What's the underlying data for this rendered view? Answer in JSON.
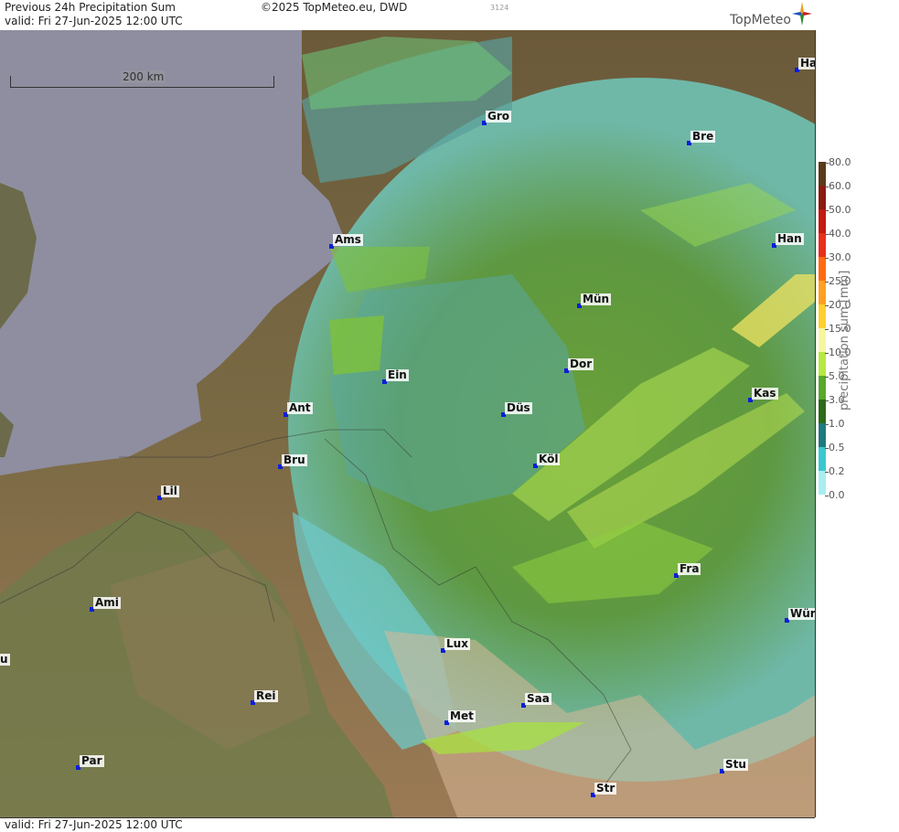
{
  "header": {
    "title": "Previous 24h Precipitation Sum",
    "valid": "valid:  Fri  27-Jun-2025 12:00 UTC",
    "copyright": "©2025 TopMeteo.eu, DWD",
    "code": "3124",
    "brand": "TopMeteo"
  },
  "footer": {
    "valid": "valid:  Fri  27-Jun-2025 12:00 UTC"
  },
  "scale": {
    "label": "200 km"
  },
  "cities": [
    {
      "name": "Gro"
    },
    {
      "name": "Ha"
    },
    {
      "name": "Bre"
    },
    {
      "name": "Ams"
    },
    {
      "name": "Han"
    },
    {
      "name": "Mün"
    },
    {
      "name": "Ein"
    },
    {
      "name": "Dor"
    },
    {
      "name": "Ant"
    },
    {
      "name": "Düs"
    },
    {
      "name": "Kas"
    },
    {
      "name": "Bru"
    },
    {
      "name": "Köl"
    },
    {
      "name": "Lil"
    },
    {
      "name": "Fra"
    },
    {
      "name": "Ami"
    },
    {
      "name": "Wür"
    },
    {
      "name": "u"
    },
    {
      "name": "Lux"
    },
    {
      "name": "Rei"
    },
    {
      "name": "Saa"
    },
    {
      "name": "Met"
    },
    {
      "name": "Par"
    },
    {
      "name": "Stu"
    },
    {
      "name": "Str"
    }
  ],
  "legend": {
    "title": "precipitation sum [mm]",
    "ticks": [
      "80.0",
      "60.0",
      "50.0",
      "40.0",
      "30.0",
      "25.0",
      "20.0",
      "15.0",
      "10.0",
      "5.0",
      "3.0",
      "1.0",
      "0.5",
      "0.2",
      "0.0"
    ],
    "colors": [
      "#5a3a1a",
      "#8b1a10",
      "#c21a10",
      "#e8301a",
      "#ff6a10",
      "#ffa020",
      "#ffd030",
      "#f6f6a0",
      "#b8e840",
      "#5aa82a",
      "#2e6a18",
      "#1e7a80",
      "#3ac8d0",
      "#a8eef0",
      "#ffffff"
    ]
  },
  "colors": {
    "sea": "#8e8ea0",
    "land": "#7a6a4a",
    "radar_green": "#6aa040",
    "radar_cyan": "#6ccfd0"
  }
}
